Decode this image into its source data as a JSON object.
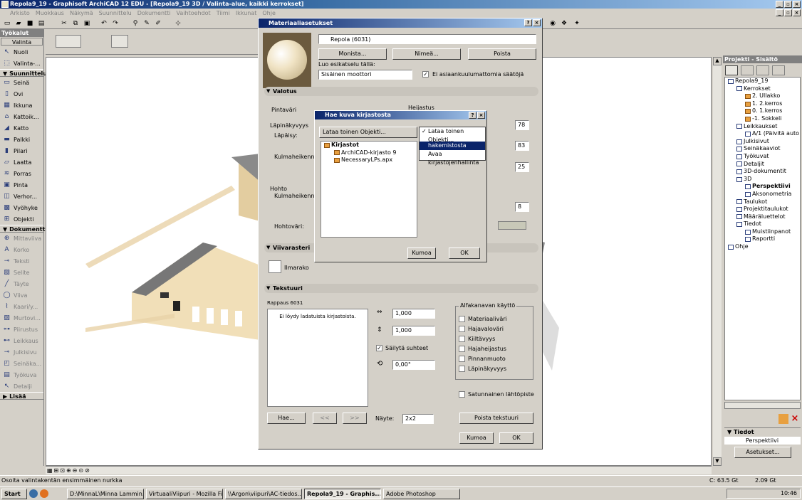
{
  "window_title": "Repola9_19 - Graphisoft ArchiCAD 12 EDU - [Repola9_19 3D / Valinta-alue, kaikki kerrokset]",
  "menu": [
    "Arkisto",
    "Muokkaus",
    "Näkymä",
    "Suunnittelu",
    "Dokumentti",
    "Vaihtoehdot",
    "Tiimi",
    "Ikkunat",
    "Ohje"
  ],
  "toolbox": {
    "title": "Työkalut",
    "valinta_header": "Valinta",
    "groups": [
      {
        "label": "Valinta",
        "items": [
          "Nuoli",
          "Valinta-..."
        ]
      },
      {
        "label": "Suunnittelu",
        "items": [
          "Seinä",
          "Ovi",
          "Ikkuna",
          "Kattoik...",
          "Katto",
          "Palkki",
          "Pilari",
          "Laatta",
          "Porras",
          "Pinta",
          "Verhor...",
          "Vyöhyke",
          "Objekti"
        ]
      },
      {
        "label": "Dokumentti",
        "items": [
          "Mittaviiva",
          "Korko",
          "Teksti",
          "Selite",
          "Täyte",
          "Viiva",
          "Kaari/y...",
          "Murtovi...",
          "Piirustus",
          "Leikkaus",
          "Julkisivu",
          "Seinäka...",
          "Työkuva",
          "Detalji"
        ]
      },
      {
        "label": "Lisää",
        "items": []
      }
    ]
  },
  "material_dialog": {
    "title": "Materiaaliasetukset",
    "material_name": "Repola (6031)",
    "buttons": {
      "duplicate": "Monista...",
      "rename": "Nimeä...",
      "delete": "Poista"
    },
    "preview_label": "Luo esikatselu tällä:",
    "preview_engine": "Sisäinen moottori",
    "ignore_check": "Ei asiaankuulumattomia säätöjä",
    "lighting_section": "Valotus",
    "surface_color": "Pintaväri",
    "reflection": "Heijastus",
    "transparency_group": "Läpinäkyvyys",
    "transparency": "Läpäisy:",
    "angle_attenuation": "Kulmaheikennös:",
    "glow_group": "Hohto",
    "glow_angle": "Kulmaheikennös:",
    "glow_color": "Hohtoväri:",
    "values": {
      "v1": "78",
      "v2": "83",
      "v3": "25",
      "v4": "8"
    },
    "vector_hatch_section": "Viivarasteri",
    "hatch_label": "Ilmarako",
    "texture_section": "Tekstuuri",
    "texture_name": "Rappaus 6031",
    "texture_error": "Ei löydy ladatuista kirjastoista.",
    "width_value": "1,000",
    "height_value": "1,000",
    "keep_ratio": "Säilytä suhteet",
    "angle_value": "0,00°",
    "alpha_group": "Alfakanavan käyttö",
    "alpha_options": [
      "Materiaaliväri",
      "Hajavaloväri",
      "Kiiltävyys",
      "Hajaheijastus",
      "Pinnanmuoto",
      "Läpinäkyvyys"
    ],
    "random_start": "Satunnainen lähtöpiste",
    "search_button": "Hae...",
    "prev": "<<",
    "next": ">>",
    "sample_label": "Näyte:",
    "sample_value": "2x2",
    "delete_texture": "Poista tekstuuri",
    "cancel": "Kumoa",
    "ok": "OK"
  },
  "library_dialog": {
    "title": "Hae kuva kirjastosta",
    "dropdown": "Lataa toinen Objekti...",
    "menu_items": [
      "Lataa toinen Objekti...",
      "hakemistosta",
      "Avaa kirjastojenhallinta"
    ],
    "tree": [
      "Kirjastot",
      "ArchiCAD-kirjasto 9",
      "NecessaryLPs.apx"
    ],
    "cancel": "Kumoa",
    "ok": "OK"
  },
  "project_tree": {
    "title": "Projekti - Sisältö",
    "items": [
      "Repola9_19",
      "Kerrokset",
      "2. Ullakko",
      "1. 2.kerros",
      "0. 1.kerros",
      "-1. Sokkeli",
      "Leikkaukset",
      "A/1 (Päivitä auto",
      "Julkisivut",
      "Seinäkaaviot",
      "Työkuvat",
      "Detaljit",
      "3D-dokumentit",
      "3D",
      "Perspektiivi",
      "Aksonometria",
      "Taulukot",
      "Projektitaulukot",
      "Määräluettelot",
      "Tiedot",
      "Muistiinpanot",
      "Raportti",
      "Ohje"
    ],
    "info_title": "Tiedot",
    "info_value": "Perspektiivi",
    "settings_button": "Asetukset..."
  },
  "status": {
    "message": "Osoita valintakentän ensimmäinen nurkka",
    "disk_c": "C: 63.5 Gt",
    "mem": "2.09 Gt"
  },
  "taskbar": {
    "start": "Start",
    "tasks": [
      "D:\\MinnaL\\Minna Lammin...",
      "VirtuaaliViipuri - Mozilla Fi...",
      "\\\\Argon\\viipuri\\AC-tiedos...",
      "Repola9_19 - Graphis...",
      "Adobe Photoshop"
    ],
    "clock": "10:46"
  }
}
